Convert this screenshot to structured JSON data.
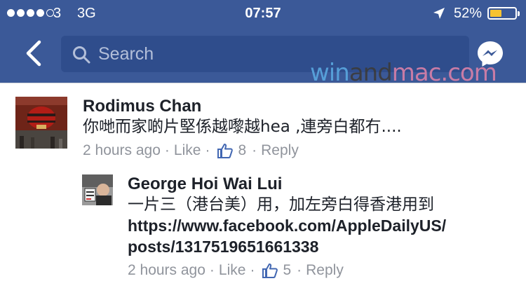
{
  "status_bar": {
    "carrier": "3",
    "network": "3G",
    "time": "07:57",
    "battery": "52%",
    "battery_level": 0.52,
    "battery_color": "#f7c331"
  },
  "header": {
    "background": "#3b5998",
    "back_icon": "chevron-left-icon",
    "search_placeholder": "Search",
    "messenger_icon": "messenger-icon"
  },
  "watermark": {
    "part1": "win",
    "part2": "and",
    "part3": "mac.com"
  },
  "comments": [
    {
      "author": "Rodimus Chan",
      "text": "你哋而家啲片堅係越嚟越hea ,連旁白都冇....",
      "time": "2 hours ago",
      "like_label": "Like",
      "likes": "8",
      "reply_label": "Reply"
    },
    {
      "author": "George Hoi Wai Lui",
      "text": "一片三（港台美）用，加左旁白得香港用到",
      "link_line1": "https://www.facebook.com/AppleDailyUS/",
      "link_line2": "posts/1317519651661338",
      "time": "2 hours ago",
      "like_label": "Like",
      "likes": "5",
      "reply_label": "Reply"
    }
  ]
}
